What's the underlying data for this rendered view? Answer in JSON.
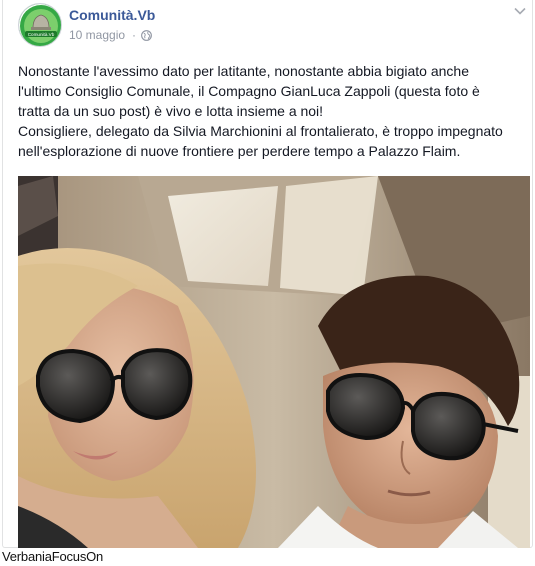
{
  "post": {
    "author": "Comunità.Vb",
    "avatar_label": "Comunità.Vb",
    "date": "10 maggio",
    "separator": "·",
    "privacy_icon": "globe-icon",
    "options_icon": "chevron-down-icon",
    "text_lines": [
      "Nonostante l'avessimo dato per latitante, nonostante abbia bigiato anche",
      "l'ultimo Consiglio Comunale, il Compagno GianLuca Zappoli (questa foto è",
      "tratta da un suo post) è vivo e lotta insieme a noi!",
      "Consigliere, delegato da Silvia Marchionini al frontalierato, è troppo impegnato",
      "nell'esplorazione di nuove frontiere per perdere tempo a Palazzo Flaim."
    ]
  },
  "watermark": "VerbaniaFocusOn",
  "colors": {
    "link_blue": "#3b5998",
    "meta_gray": "#9197a3",
    "text": "#141823",
    "avatar_green": "#2e9e3f"
  }
}
